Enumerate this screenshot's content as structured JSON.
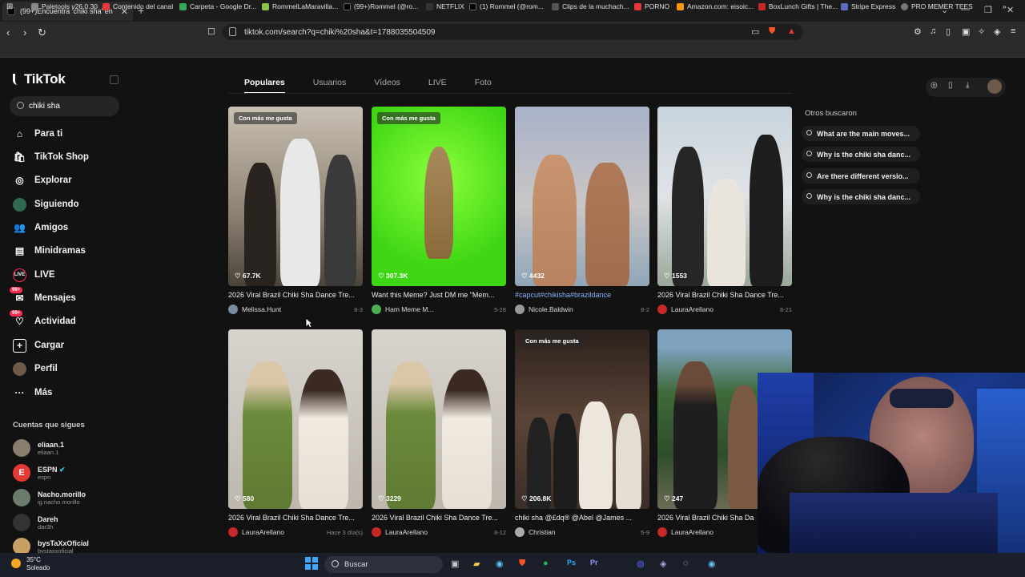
{
  "browser": {
    "tab_title": "(99+)Encuentra 'chiki sha' en",
    "url": "tiktok.com/search?q=chiki%20sha&t=1788035504509",
    "bookmarks": [
      "Paletools v26.0.30",
      "Contenido del canal",
      "Carpeta - Google Dr...",
      "RommelLaMaravilla...",
      "(99+)Rommel (@ro...",
      "NETFLIX",
      "(1) Rommel (@rom...",
      "Clips de la muchach...",
      "PORNO",
      "Amazon.com: eisoic...",
      "BoxLunch Gifts | The...",
      "Stripe Express",
      "PRO MEMER TEES"
    ]
  },
  "sidebar": {
    "logo": "TikTok",
    "search_value": "chiki sha",
    "nav": [
      {
        "label": "Para ti",
        "icon": "home-icon"
      },
      {
        "label": "TikTok Shop",
        "icon": "shop-icon"
      },
      {
        "label": "Explorar",
        "icon": "compass-icon"
      },
      {
        "label": "Siguiendo",
        "icon": "following-icon"
      },
      {
        "label": "Amigos",
        "icon": "friends-icon"
      },
      {
        "label": "Minidramas",
        "icon": "minidramas-icon"
      },
      {
        "label": "LIVE",
        "icon": "live-icon"
      },
      {
        "label": "Mensajes",
        "icon": "messages-icon",
        "badge": "99+"
      },
      {
        "label": "Actividad",
        "icon": "activity-icon",
        "badge": "99+"
      },
      {
        "label": "Cargar",
        "icon": "upload-icon"
      },
      {
        "label": "Perfil",
        "icon": "profile-icon"
      },
      {
        "label": "Más",
        "icon": "more-icon"
      }
    ],
    "following_header": "Cuentas que sigues",
    "accounts": [
      {
        "name": "eliaan.1",
        "handle": "eliaan.1"
      },
      {
        "name": "ESPN",
        "handle": "espn"
      },
      {
        "name": "Nacho.morillo",
        "handle": "ig.nacho.morillo"
      },
      {
        "name": "Dareh",
        "handle": "dar3h"
      },
      {
        "name": "bysTaXxOficial",
        "handle": "bystaxxoficial"
      }
    ]
  },
  "search_tabs": [
    "Populares",
    "Usuarios",
    "Vídeos",
    "LIVE",
    "Foto"
  ],
  "results": [
    {
      "pill": "Con más me gusta",
      "likes": "67.7K",
      "title": "2026 Viral Brazil Chiki Sha Dance Tre...",
      "author": "Melissa.Hunt",
      "date": "8-3"
    },
    {
      "pill": "Con más me gusta",
      "likes": "307.3K",
      "title": "Want this Meme? Just DM me \"Mem...",
      "author": "Ham Meme M...",
      "date": "5-28"
    },
    {
      "pill": "",
      "likes": "4432",
      "title": "#capcut#chikisha#brazildance",
      "author": "Nicole.Baldwin",
      "date": "8-2"
    },
    {
      "pill": "",
      "likes": "1553",
      "title": "2026 Viral Brazil Chiki Sha Dance Tre...",
      "author": "LauraArellano",
      "date": "8-21"
    },
    {
      "pill": "",
      "likes": "580",
      "title": "2026 Viral Brazil Chiki Sha Dance Tre...",
      "author": "LauraArellano",
      "date": "Hace 3 día(s)"
    },
    {
      "pill": "",
      "likes": "3229",
      "title": "2026 Viral Brazil Chiki Sha Dance Tre...",
      "author": "LauraArellano",
      "date": "8-12"
    },
    {
      "pill": "Con más me gusta",
      "likes": "206.8K",
      "title": "chiki sha @£dq® @Abel @James ...",
      "author": "Christian",
      "date": "5-9"
    },
    {
      "pill": "",
      "likes": "247",
      "title": "2026 Viral Brazil Chiki Sha Da",
      "author": "LauraArellano",
      "date": ""
    }
  ],
  "related": {
    "header": "Otros buscaron",
    "items": [
      "What are the main moves...",
      "Why is the chiki sha danc...",
      "Are there different versio...",
      "Why is the chiki sha danc..."
    ]
  },
  "taskbar": {
    "temp": "35°C",
    "weather": "Soleado",
    "search": "Buscar"
  }
}
